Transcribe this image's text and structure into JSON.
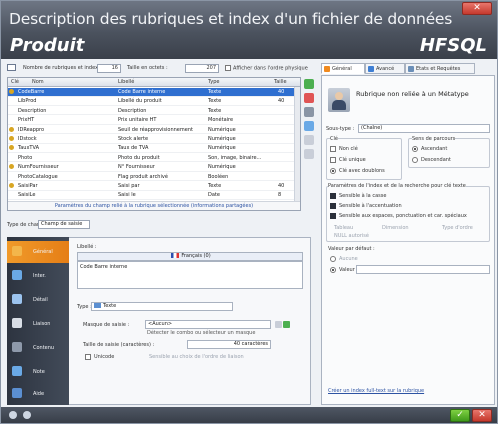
{
  "window": {
    "title": "Description des rubriques et index d'un fichier de données",
    "close_glyph": "✕"
  },
  "header": {
    "app_title": "Produit",
    "brand": "HFSQL"
  },
  "toolbar": {
    "count_label": "Nombre de rubriques et index :",
    "count_value": "16",
    "size_label": "Taille en octets :",
    "size_value": "207",
    "physical_label": "Afficher dans l'ordre physique"
  },
  "grid": {
    "columns": [
      "Clé",
      "Nom",
      "Libellé",
      "Type",
      "Taille"
    ],
    "rows": [
      {
        "key": true,
        "name": "CodeBarre",
        "label": "Code Barre interne",
        "type": "Texte",
        "size": "40",
        "selected": true
      },
      {
        "key": false,
        "name": "LibProd",
        "label": "Libellé du produit",
        "type": "Texte",
        "size": "40",
        "selected": false
      },
      {
        "key": false,
        "name": "Description",
        "label": "Description",
        "type": "Texte",
        "size": "",
        "selected": false
      },
      {
        "key": false,
        "name": "PrixHT",
        "label": "Prix unitaire HT",
        "type": "Monétaire",
        "size": "",
        "selected": false
      },
      {
        "key": true,
        "name": "IDReappro",
        "label": "Seuil de réapprovisionnement",
        "type": "Numérique",
        "size": "",
        "selected": false
      },
      {
        "key": true,
        "name": "IDstock",
        "label": "Stock alerte",
        "type": "Numérique",
        "size": "",
        "selected": false
      },
      {
        "key": true,
        "name": "TauxTVA",
        "label": "Taux de TVA",
        "type": "Numérique",
        "size": "",
        "selected": false
      },
      {
        "key": false,
        "name": "Photo",
        "label": "Photo du produit",
        "type": "Son, image, binaire...",
        "size": "",
        "selected": false
      },
      {
        "key": true,
        "name": "NumFournisseur",
        "label": "N° Fournisseur",
        "type": "Numérique",
        "size": "",
        "selected": false
      },
      {
        "key": false,
        "name": "PhotoCatalogue",
        "label": "Flag produit archivé",
        "type": "Booléen",
        "size": "",
        "selected": false
      },
      {
        "key": true,
        "name": "SaisiPar",
        "label": "Saisi par",
        "type": "Texte",
        "size": "40",
        "selected": false
      },
      {
        "key": false,
        "name": "SaisiLe",
        "label": "Saisi le",
        "type": "Date",
        "size": "8",
        "selected": false
      }
    ],
    "footer": "Paramètres du champ relié à la rubrique sélectionnée (informations partagées)"
  },
  "field_type": {
    "label": "Type de champ",
    "value": "Champ de saisie"
  },
  "vtabs": [
    {
      "label": "Général",
      "color": "#f3b64b",
      "active": true
    },
    {
      "label": "Inter.",
      "color": "#6aa9e6",
      "active": false
    },
    {
      "label": "Détail",
      "color": "#9bc3ee",
      "active": false
    },
    {
      "label": "Liaison",
      "color": "#d9dee6",
      "active": false
    },
    {
      "label": "Contenu",
      "color": "#8e99aa",
      "active": false
    },
    {
      "label": "Note",
      "color": "#6aa9e6",
      "active": false
    },
    {
      "label": "Aide",
      "color": "#5b8fd1",
      "active": false
    }
  ],
  "detail": {
    "libelle_label": "Libellé :",
    "lang_label": "Français (0)",
    "libelle_value": "Code Barre interne",
    "type_label": "Type :",
    "type_value": "Texte",
    "mask_label": "Masque de saisie :",
    "mask_value": "<Aucun>",
    "mask_hint": "Détecter le combo ou sélecteur un masque",
    "size_label": "Taille de saisie (caractères) :",
    "size_value": "40 caractères",
    "unicode_label": "Unicode",
    "unicode_hint": "Sensible au choix de l'ordre de liaison"
  },
  "right_tabs": [
    {
      "label": "Général",
      "color": "#f08a1e",
      "active": true
    },
    {
      "label": "Avancé",
      "color": "#3f7fd4",
      "active": false
    },
    {
      "label": "Etats et Requêtes",
      "color": "#6b8fb8",
      "active": false
    }
  ],
  "right": {
    "meta_title": "Rubrique non reliée à un Métatype",
    "subtype_label": "Sous-type :",
    "subtype_value": "(Chaîne)",
    "key_group": "Clé",
    "key_none": "Non clé",
    "key_unique": "Clé unique",
    "key_dup": "Clé avec doublons",
    "sort_group": "Sens de parcours",
    "sort_asc": "Ascendant",
    "sort_desc": "Descendant",
    "search_group": "Paramètres de l'index et de la recherche pour clé texte",
    "case_label": "Sensible à la casse",
    "accent_label": "Sensible à l'accentuation",
    "spaces_label": "Sensible aux espaces, ponctuation et car. spéciaux",
    "lang_lbl": "Tableau",
    "lang_dim": "Dimension",
    "lang_tri": "Type d'ordre",
    "null_label": "NULL autorisé",
    "default_group": "Valeur par défaut :",
    "default_none": "Aucune",
    "default_value": "Valeur",
    "link_text": "Créer un index full-text sur la rubrique"
  },
  "statusbar": {
    "ok_glyph": "✓",
    "cancel_glyph": "✕"
  }
}
